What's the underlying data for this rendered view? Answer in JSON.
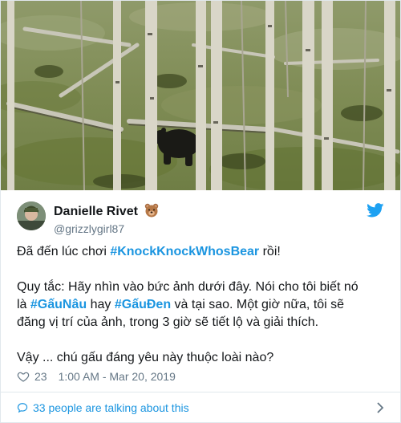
{
  "tweet": {
    "display_name": "Danielle Rivet",
    "handle": "@grizzlygirl87",
    "text_intro": "Đã đến lúc chơi ",
    "hashtag_main": "#KnockKnockWhosBear",
    "text_intro_end": " rồi!",
    "rules_1": "Quy tắc: Hãy nhìn vào bức ảnh dưới đây. Nói cho tôi biết nó là ",
    "hashtag_brown": "#GấuNâu",
    "rules_or": " hay ",
    "hashtag_black": "#GấuĐen",
    "rules_2": " và tại sao. Một giờ nữa, tôi sẽ đăng vị trí của ảnh, trong 3 giờ sẽ tiết lộ và giải thích.",
    "question": "Vậy ... chú gấu đáng yêu này thuộc loài nào?",
    "likes": "23",
    "timestamp": "1:00 AM - Mar 20, 2019",
    "talking": "33 people are talking about this"
  },
  "icons": {
    "bear": "bear-face-emoji",
    "twitter": "twitter-bird-icon",
    "like": "heart-icon",
    "comments": "speech-bubble-icon",
    "more": "chevron-right-icon"
  },
  "colors": {
    "link": "#1b95e0",
    "text": "#14171a",
    "muted": "#657786",
    "border": "#e1e8ed"
  }
}
